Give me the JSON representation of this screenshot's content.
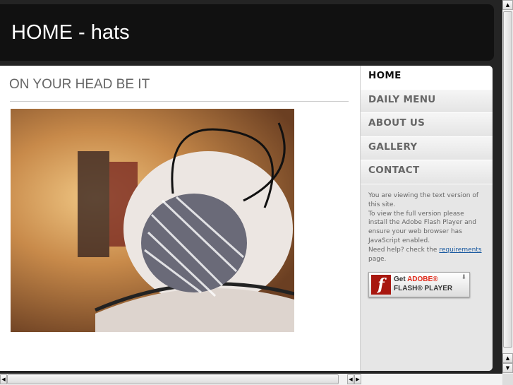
{
  "header": {
    "title": "HOME - hats"
  },
  "main": {
    "heading": "ON YOUR HEAD BE IT"
  },
  "nav": [
    {
      "label": "HOME"
    },
    {
      "label": "DAILY MENU"
    },
    {
      "label": "ABOUT US"
    },
    {
      "label": "GALLERY"
    },
    {
      "label": "CONTACT"
    }
  ],
  "info": {
    "line1": "You are viewing the text version of this site.",
    "line2": "To view the full version please install the Adobe Flash Player and ensure your web browser has JavaScript enabled.",
    "line3": "Need help? check the ",
    "link": "requirements",
    "line4": " page."
  },
  "flash_badge": {
    "get": "Get ",
    "adobe": "ADOBE®",
    "player": "FLASH® PLAYER"
  }
}
